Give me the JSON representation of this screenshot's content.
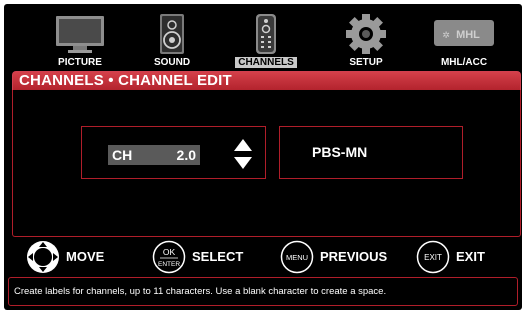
{
  "menu": {
    "items": [
      {
        "label": "PICTURE",
        "icon": "tv-monitor-icon",
        "active": false
      },
      {
        "label": "SOUND",
        "icon": "speaker-icon",
        "active": false
      },
      {
        "label": "CHANNELS",
        "icon": "remote-control-icon",
        "active": true
      },
      {
        "label": "SETUP",
        "icon": "gear-icon",
        "active": false
      },
      {
        "label": "MHL/ACC",
        "icon": "mhl-logo-icon",
        "active": false
      }
    ],
    "mhl_logo_text": "MHL"
  },
  "title": "CHANNELS • CHANNEL EDIT",
  "channel": {
    "label": "CH",
    "number": "2.0"
  },
  "channel_name": "PBS-MN",
  "controls": {
    "move": {
      "label": "MOVE"
    },
    "select": {
      "button_top": "OK",
      "button_bottom": "ENTER",
      "label": "SELECT"
    },
    "previous": {
      "button": "MENU",
      "label": "PREVIOUS"
    },
    "exit": {
      "button": "EXIT",
      "label": "EXIT"
    }
  },
  "help_text": "Create labels for channels, up to 11 characters. Use a blank character to create a space.",
  "colors": {
    "accent_red": "#b3232d",
    "background": "#000000",
    "text": "#ffffff"
  }
}
